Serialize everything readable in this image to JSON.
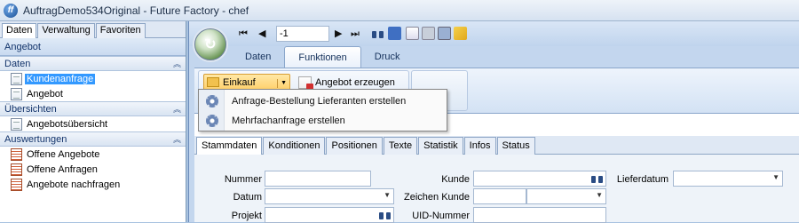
{
  "window": {
    "title": "AuftragDemo534Original - Future Factory - chef",
    "logo_letter": "ff"
  },
  "leftnav": {
    "tabs": [
      "Daten",
      "Verwaltung",
      "Favoriten"
    ],
    "header": "Angebot",
    "groups": [
      {
        "title": "Daten",
        "items": [
          "Kundenanfrage",
          "Angebot"
        ]
      },
      {
        "title": "Übersichten",
        "items": [
          "Angebotsübersicht"
        ]
      },
      {
        "title": "Auswertungen",
        "items": [
          "Offene Angebote",
          "Offene Anfragen",
          "Angebote nachfragen"
        ]
      }
    ],
    "selected_item": "Kundenanfrage"
  },
  "toolbar": {
    "record_value": "-1"
  },
  "ribbon": {
    "tabs": [
      "Daten",
      "Funktionen",
      "Druck"
    ],
    "active_tab": "Funktionen",
    "einkauf_label": "Einkauf",
    "angebot_label": "Angebot erzeugen"
  },
  "dropdown": {
    "items": [
      "Anfrage-Bestellung Lieferanten erstellen",
      "Mehrfachanfrage erstellen"
    ]
  },
  "content": {
    "tabs": [
      "Stammdaten",
      "Konditionen",
      "Positionen",
      "Texte",
      "Statistik",
      "Infos",
      "Status"
    ],
    "active_tab": "Stammdaten",
    "labels": {
      "nummer": "Nummer",
      "datum": "Datum",
      "projekt": "Projekt",
      "kunde": "Kunde",
      "zeichen_kunde": "Zeichen Kunde",
      "uid": "UID-Nummer",
      "lieferdatum": "Lieferdatum"
    }
  }
}
